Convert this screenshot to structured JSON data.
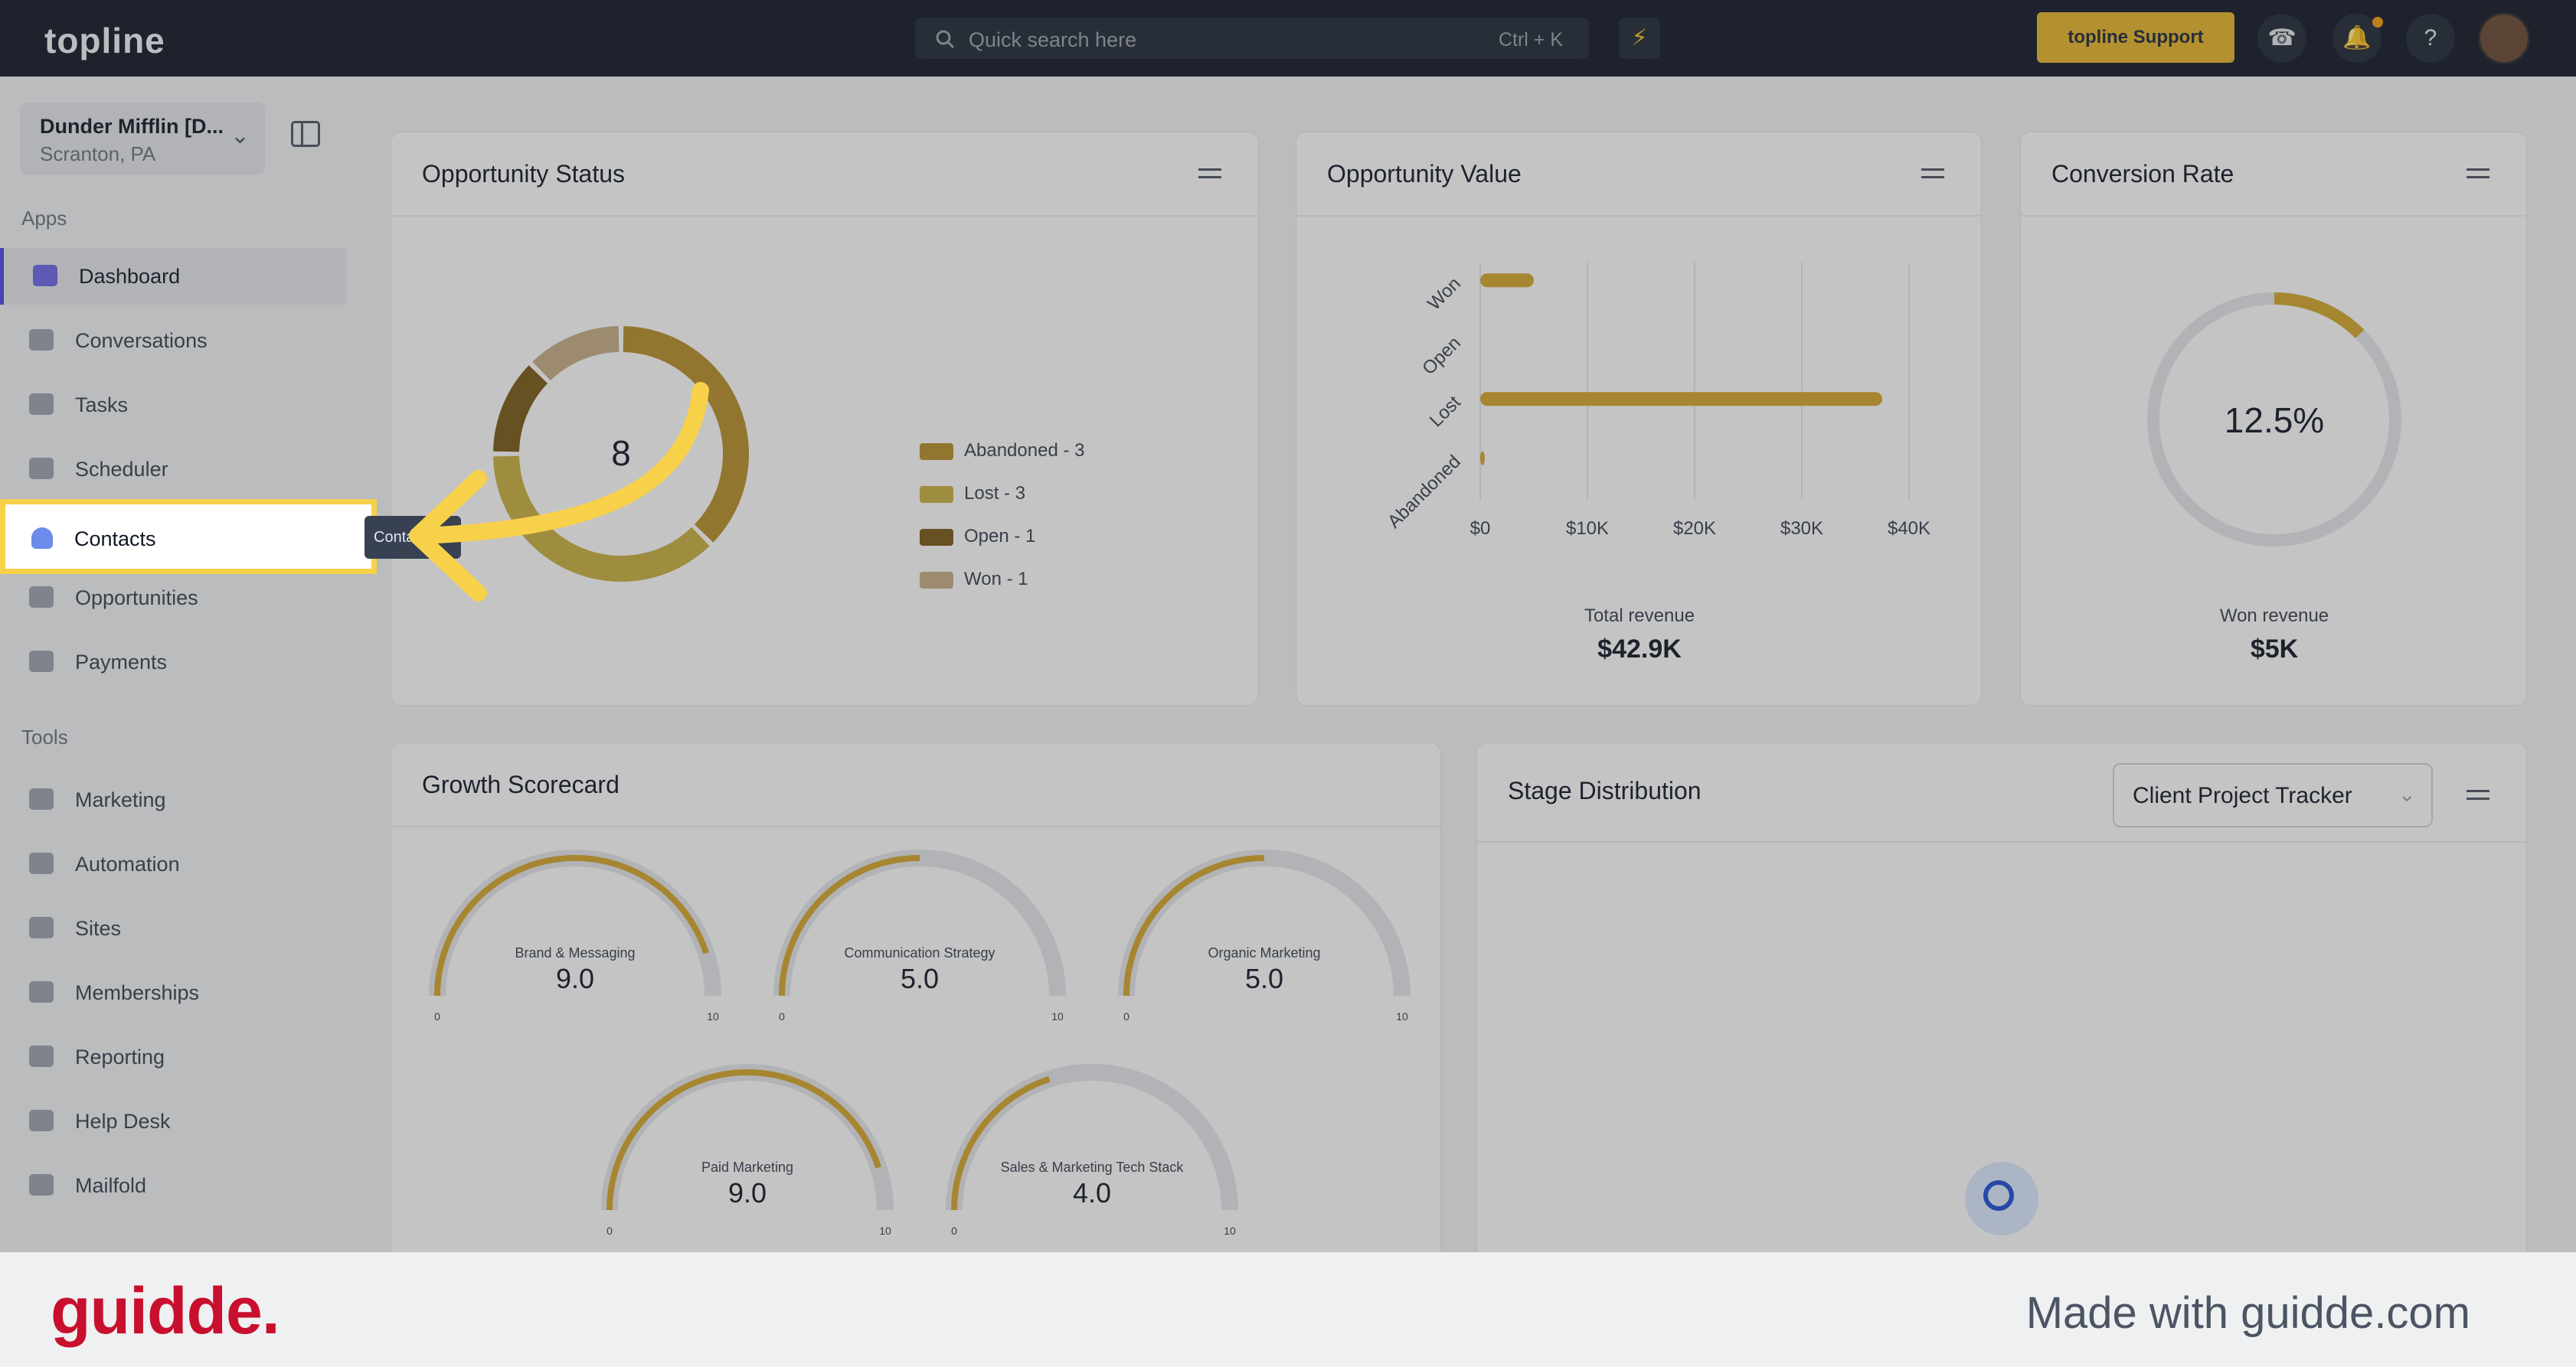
{
  "app": {
    "logo": "topline"
  },
  "header": {
    "search_placeholder": "Quick search here",
    "search_shortcut": "Ctrl + K",
    "support_label": "topline Support",
    "bolt_icon": "lightning-icon",
    "phone_icon": "phone-icon",
    "bell_icon": "bell-icon",
    "help_icon": "help-icon"
  },
  "sidebar": {
    "account_name": "Dunder Mifflin [D...",
    "account_location": "Scranton, PA",
    "apps_heading": "Apps",
    "tools_heading": "Tools",
    "apps": [
      {
        "label": "Dashboard",
        "icon": "dashboard-icon"
      },
      {
        "label": "Conversations",
        "icon": "chat-icon"
      },
      {
        "label": "Tasks",
        "icon": "clipboard-icon"
      },
      {
        "label": "Scheduler",
        "icon": "calendar-icon"
      },
      {
        "label": "Contacts",
        "icon": "person-icon"
      },
      {
        "label": "Opportunities",
        "icon": "target-icon"
      },
      {
        "label": "Payments",
        "icon": "card-icon"
      }
    ],
    "tools": [
      {
        "label": "Marketing",
        "icon": "megaphone-icon"
      },
      {
        "label": "Automation",
        "icon": "gears-icon"
      },
      {
        "label": "Sites",
        "icon": "globe-icon"
      },
      {
        "label": "Memberships",
        "icon": "users-icon"
      },
      {
        "label": "Reporting",
        "icon": "pie-icon"
      },
      {
        "label": "Help Desk",
        "icon": "help-icon"
      },
      {
        "label": "Mailfold",
        "icon": "mail-icon"
      }
    ],
    "tooltip": "Contacts"
  },
  "cards": {
    "opportunity_status": {
      "title": "Opportunity Status",
      "total": "8",
      "legend": [
        {
          "label": "Abandoned - 3",
          "color": "#b8902a"
        },
        {
          "label": "Lost - 3",
          "color": "#c9b03f"
        },
        {
          "label": "Open - 1",
          "color": "#7a5a16"
        },
        {
          "label": "Won - 1",
          "color": "#c8ae86"
        }
      ]
    },
    "opportunity_value": {
      "title": "Opportunity Value",
      "total_label": "Total revenue",
      "total_value": "$42.9K"
    },
    "conversion_rate": {
      "title": "Conversion Rate",
      "rate": "12.5%",
      "won_label": "Won revenue",
      "won_value": "$5K"
    },
    "growth_scorecard": {
      "title": "Growth Scorecard",
      "gauges": [
        {
          "label": "Brand & Messaging",
          "value": "9.0",
          "min": "0",
          "max": "10"
        },
        {
          "label": "Communication Strategy",
          "value": "5.0",
          "min": "0",
          "max": "10"
        },
        {
          "label": "Organic Marketing",
          "value": "5.0",
          "min": "0",
          "max": "10"
        },
        {
          "label": "Paid Marketing",
          "value": "9.0",
          "min": "0",
          "max": "10"
        },
        {
          "label": "Sales & Marketing Tech Stack",
          "value": "4.0",
          "min": "0",
          "max": "10"
        }
      ]
    },
    "stage_distribution": {
      "title": "Stage Distribution",
      "pipeline": "Client Project Tracker"
    }
  },
  "chart_data": [
    {
      "type": "pie",
      "categories": [
        "Abandoned",
        "Lost",
        "Open",
        "Won"
      ],
      "values": [
        3,
        3,
        1,
        1
      ],
      "colors": [
        "#b8902a",
        "#c9b03f",
        "#7a5a16",
        "#c8ae86"
      ]
    },
    {
      "type": "bar",
      "orientation": "horizontal",
      "categories": [
        "Won",
        "Open",
        "Lost",
        "Abandoned"
      ],
      "values": [
        5000,
        0,
        37500,
        400
      ],
      "xticks": [
        "$0",
        "$10K",
        "$20K",
        "$30K",
        "$40K"
      ],
      "xlim": [
        0,
        40000
      ],
      "color": "#d4a72c"
    }
  ],
  "footer": {
    "brand": "guidde.",
    "made_with": "Made with guidde.com"
  }
}
